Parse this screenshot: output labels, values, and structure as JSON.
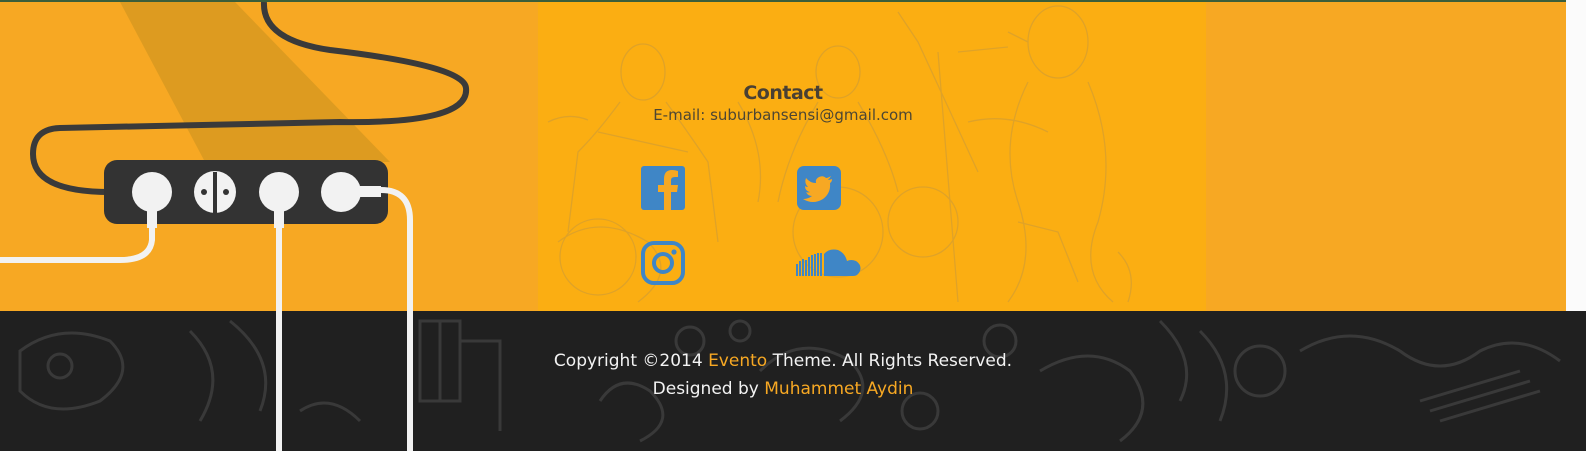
{
  "contact": {
    "title": "Contact",
    "email_label": "E-mail:",
    "email": "suburbansensi@gmail.com"
  },
  "social": [
    {
      "icon": "facebook-icon",
      "color": "#3f86c6"
    },
    {
      "icon": "twitter-icon",
      "color": "#3f86c6"
    },
    {
      "icon": "instagram-icon",
      "color": "#3f86c6"
    },
    {
      "icon": "soundcloud-icon",
      "color": "#3f86c6"
    }
  ],
  "footer": {
    "copyright_prefix": "Copyright ©2014",
    "theme_name": "Evento",
    "copyright_suffix": "Theme. All Rights Reserved.",
    "designed_by": "Designed by",
    "designer": "Muhammet Aydin"
  },
  "colors": {
    "band": "#f7a823",
    "center_panel": "#fbae12",
    "footer": "#202020",
    "accent": "#f7a823",
    "icon_blue": "#3f86c6"
  }
}
